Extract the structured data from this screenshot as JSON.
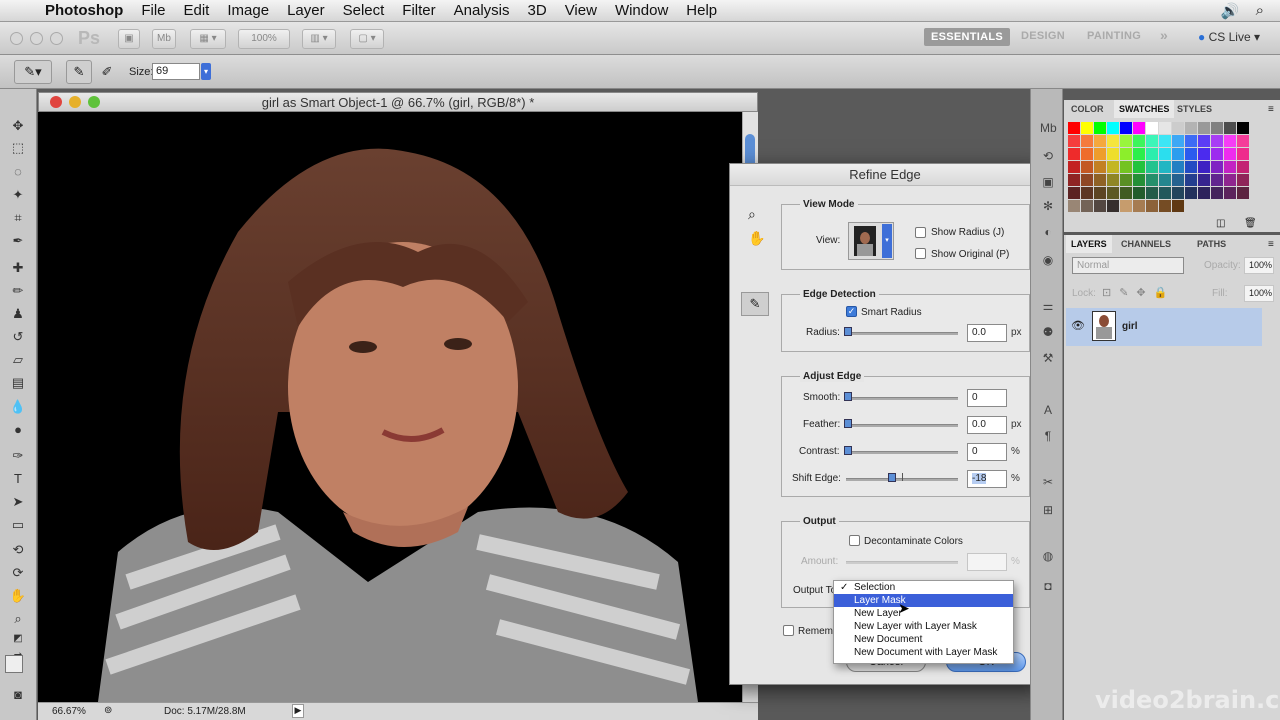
{
  "menubar": {
    "items": [
      "Photoshop",
      "File",
      "Edit",
      "Image",
      "Layer",
      "Select",
      "Filter",
      "Analysis",
      "3D",
      "View",
      "Window",
      "Help"
    ]
  },
  "appbar": {
    "zoom": "100%",
    "workspaces": [
      "ESSENTIALS",
      "DESIGN",
      "PAINTING"
    ],
    "more": "»",
    "cs_live": "CS Live"
  },
  "options": {
    "size_label": "Size:",
    "size_value": "69"
  },
  "document": {
    "title": "girl as Smart Object-1 @ 66.7% (girl, RGB/8*) *",
    "zoom": "66.67%",
    "doc_info": "Doc: 5.17M/28.8M"
  },
  "dialog": {
    "title": "Refine Edge",
    "view_mode": {
      "title": "View Mode",
      "view_label": "View:",
      "show_radius": "Show Radius (J)",
      "show_original": "Show Original (P)"
    },
    "edge_detection": {
      "title": "Edge Detection",
      "smart_radius": "Smart Radius",
      "radius_label": "Radius:",
      "radius_value": "0.0",
      "radius_unit": "px"
    },
    "adjust_edge": {
      "title": "Adjust Edge",
      "smooth_label": "Smooth:",
      "smooth_value": "0",
      "feather_label": "Feather:",
      "feather_value": "0.0",
      "feather_unit": "px",
      "contrast_label": "Contrast:",
      "contrast_value": "0",
      "contrast_unit": "%",
      "shift_label": "Shift Edge:",
      "shift_value": "-18",
      "shift_unit": "%"
    },
    "output": {
      "title": "Output",
      "decontaminate": "Decontaminate Colors",
      "amount_label": "Amount:",
      "amount_unit": "%",
      "output_to_label": "Output To",
      "remember": "Remember"
    },
    "output_menu": {
      "checked": "✓",
      "items": [
        "Selection",
        "Layer Mask",
        "New Layer",
        "New Layer with Layer Mask",
        "New Document",
        "New Document with Layer Mask"
      ],
      "selected_index": 1
    },
    "cancel": "Cancel",
    "ok": "OK"
  },
  "swatches_panel": {
    "tabs": [
      "COLOR",
      "SWATCHES",
      "STYLES"
    ],
    "active": "SWATCHES"
  },
  "layers_panel": {
    "tabs": [
      "LAYERS",
      "CHANNELS",
      "PATHS"
    ],
    "blend_mode": "Normal",
    "opacity_label": "Opacity:",
    "opacity_value": "100%",
    "lock_label": "Lock:",
    "fill_label": "Fill:",
    "fill_value": "100%",
    "layer_name": "girl"
  },
  "watermark": "video2brain.com",
  "colors": {
    "accent": "#3b5fd9",
    "selection_row": "#b7cbe9",
    "checkbox_on": "#3d7bd9"
  }
}
